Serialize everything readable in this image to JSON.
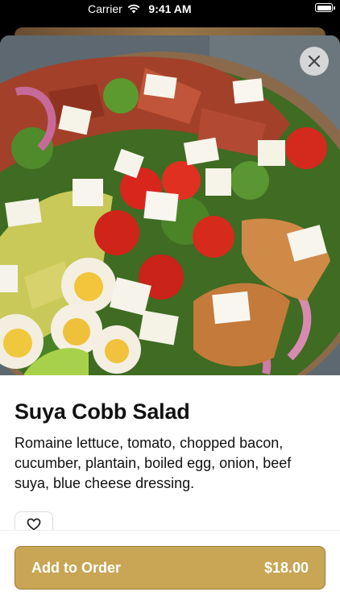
{
  "status_bar": {
    "carrier": "Carrier",
    "time": "9:41 AM"
  },
  "item": {
    "title": "Suya Cobb Salad",
    "description": "Romaine lettuce, tomato, chopped bacon, cucumber, plantain, boiled egg, onion, beef suya, blue cheese dressing.",
    "image_icon": "salad-photo"
  },
  "actions": {
    "close_icon": "close-icon",
    "favorite_icon": "heart-outline-icon",
    "add_label": "Add to Order",
    "price": "$18.00"
  },
  "colors": {
    "accent": "#c9a655",
    "accent_border": "#9c7c32",
    "text": "#111111"
  }
}
